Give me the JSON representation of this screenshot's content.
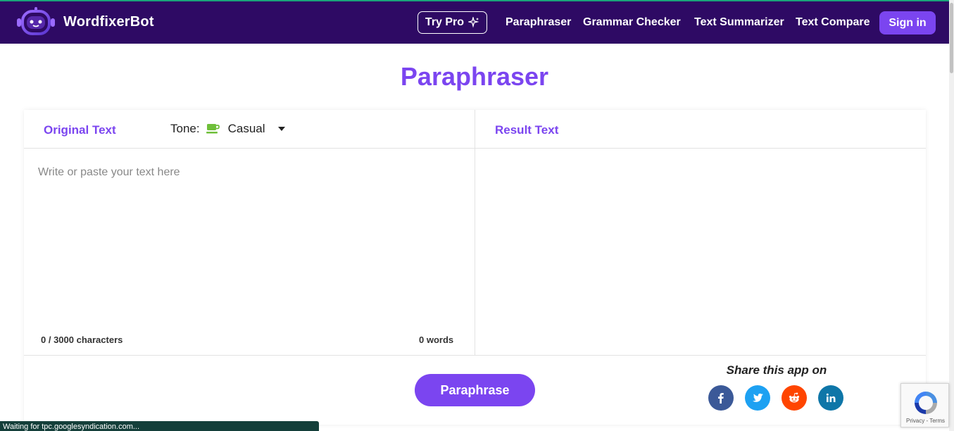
{
  "colors": {
    "navbar_bg": "#2e0a64",
    "accent": "#7b45f0",
    "facebook": "#3b5998",
    "twitter": "#1da1f2",
    "reddit": "#ff4500",
    "linkedin": "#0e76a8",
    "tone_icon": "#6fbf3a"
  },
  "header": {
    "brand": "WordfixerBot",
    "try_pro": "Try Pro",
    "try_pro_icon": "sparkle-icon",
    "nav": [
      "Paraphraser",
      "Grammar Checker",
      "Text Summarizer",
      "Text Compare"
    ],
    "sign_in": "Sign in"
  },
  "main": {
    "title": "Paraphraser",
    "original_label": "Original Text",
    "tone_label": "Tone:",
    "tone_icon": "coffee-cup-icon",
    "tone_value": "Casual",
    "result_label": "Result Text",
    "input_placeholder": "Write or paste your text here",
    "char_count": "0 / 3000 characters",
    "word_count": "0 words",
    "paraphrase_button": "Paraphrase",
    "share_label": "Share this app on",
    "social_icons": [
      "facebook-icon",
      "twitter-icon",
      "reddit-icon",
      "linkedin-icon"
    ]
  },
  "recaptcha": {
    "text": "Privacy - Terms"
  },
  "status_bar": {
    "text": "Waiting for tpc.googlesyndication.com..."
  }
}
